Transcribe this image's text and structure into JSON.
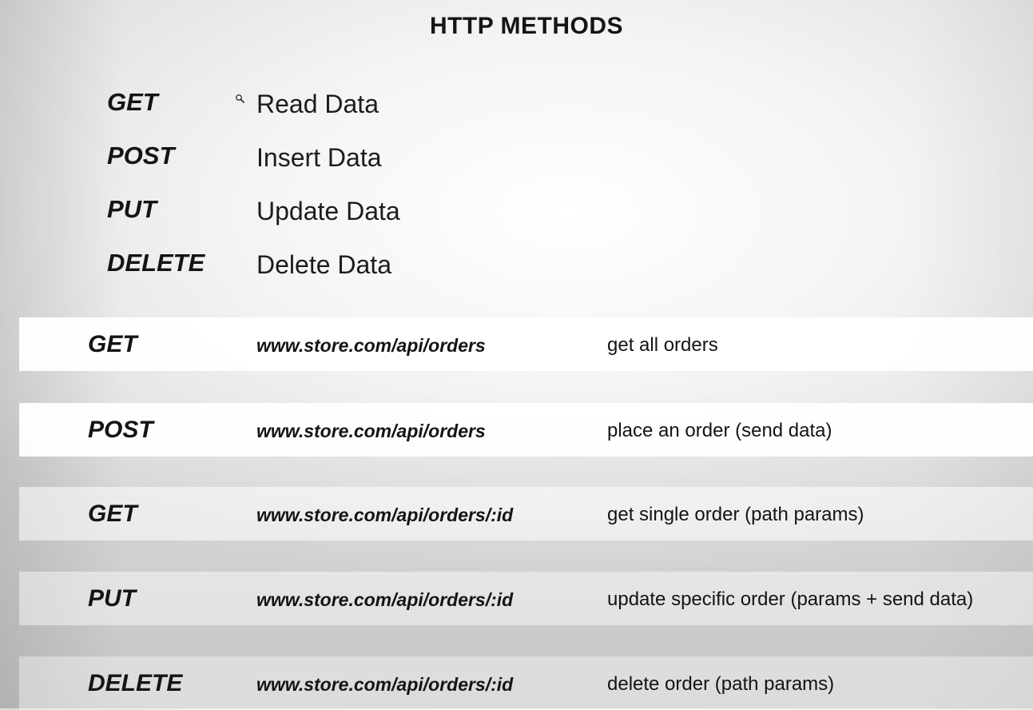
{
  "title": "HTTP METHODS",
  "methods": [
    {
      "name": "GET",
      "description": "Read Data"
    },
    {
      "name": "POST",
      "description": "Insert Data"
    },
    {
      "name": "PUT",
      "description": "Update Data"
    },
    {
      "name": "DELETE",
      "description": "Delete Data"
    }
  ],
  "endpoints": [
    {
      "method": "GET",
      "url": "www.store.com/api/orders",
      "description": "get all orders"
    },
    {
      "method": "POST",
      "url": "www.store.com/api/orders",
      "description": "place an order (send data)"
    },
    {
      "method": "GET",
      "url": "www.store.com/api/orders/:id",
      "description": "get single order (path params)"
    },
    {
      "method": "PUT",
      "url": "www.store.com/api/orders/:id",
      "description": "update specific order (params + send data)"
    },
    {
      "method": "DELETE",
      "url": "www.store.com/api/orders/:id",
      "description": "delete order (path params)"
    }
  ],
  "icons": {
    "cursor": "magnifier-cursor-icon"
  }
}
